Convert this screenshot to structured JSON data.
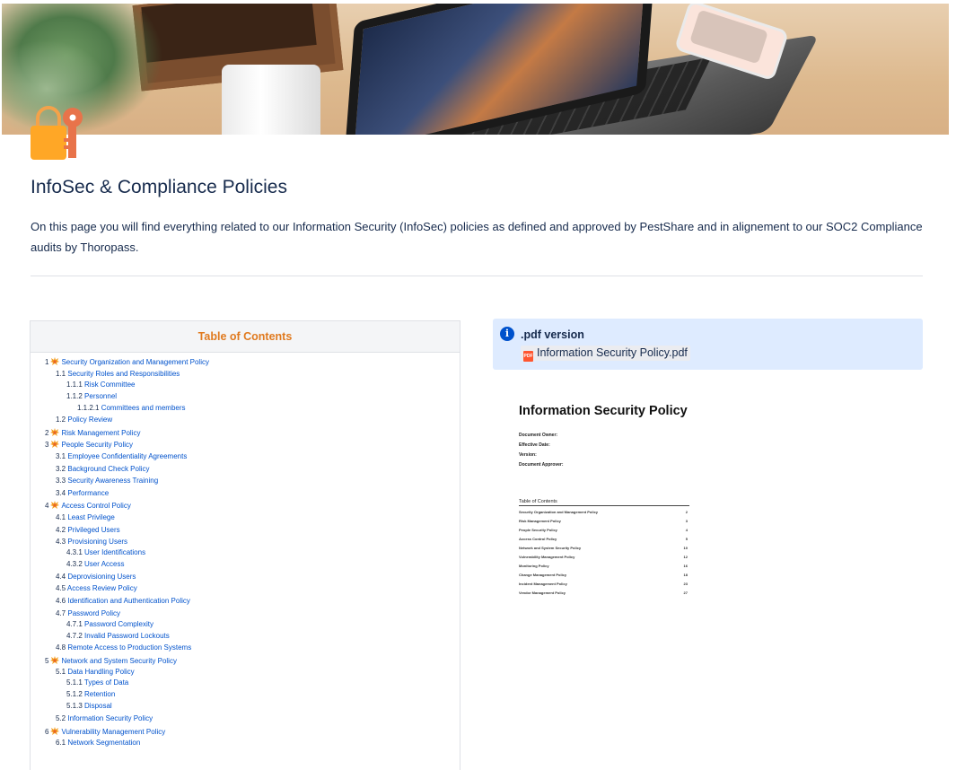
{
  "page": {
    "title": "InfoSec & Compliance Policies",
    "intro": "On this page you will find everything related to our Information Security (InfoSec) policies as defined and approved by PestShare and in alignement to our SOC2 Compliance audits by Thoropass."
  },
  "toc": {
    "heading": "Table of Contents",
    "items": [
      {
        "num": "1",
        "label": "Security Organization and Management Policy",
        "level": 0,
        "flame": true
      },
      {
        "num": "1.1",
        "label": "Security Roles and Responsibilities",
        "level": 1
      },
      {
        "num": "1.1.1",
        "label": "Risk Committee",
        "level": 2
      },
      {
        "num": "1.1.2",
        "label": "Personnel",
        "level": 2
      },
      {
        "num": "1.1.2.1",
        "label": "Committees and members",
        "level": 3
      },
      {
        "num": "1.2",
        "label": "Policy Review",
        "level": 1
      },
      {
        "num": "2",
        "label": "Risk Management Policy",
        "level": 0,
        "flame": true
      },
      {
        "num": "3",
        "label": "People Security Policy",
        "level": 0,
        "flame": true
      },
      {
        "num": "3.1",
        "label": "Employee Confidentiality Agreements",
        "level": 1
      },
      {
        "num": "3.2",
        "label": "Background Check Policy",
        "level": 1
      },
      {
        "num": "3.3",
        "label": "Security Awareness Training",
        "level": 1
      },
      {
        "num": "3.4",
        "label": "Performance",
        "level": 1
      },
      {
        "num": "4",
        "label": "Access Control Policy",
        "level": 0,
        "flame": true
      },
      {
        "num": "4.1",
        "label": "Least Privilege",
        "level": 1
      },
      {
        "num": "4.2",
        "label": "Privileged Users",
        "level": 1
      },
      {
        "num": "4.3",
        "label": "Provisioning Users",
        "level": 1
      },
      {
        "num": "4.3.1",
        "label": "User Identifications",
        "level": 2
      },
      {
        "num": "4.3.2",
        "label": "User Access",
        "level": 2
      },
      {
        "num": "4.4",
        "label": "Deprovisioning Users",
        "level": 1
      },
      {
        "num": "4.5",
        "label": "Access Review Policy",
        "level": 1
      },
      {
        "num": "4.6",
        "label": "Identification and Authentication Policy",
        "level": 1
      },
      {
        "num": "4.7",
        "label": "Password Policy",
        "level": 1
      },
      {
        "num": "4.7.1",
        "label": "Password Complexity",
        "level": 2
      },
      {
        "num": "4.7.2",
        "label": "Invalid Password Lockouts",
        "level": 2
      },
      {
        "num": "4.8",
        "label": "Remote Access to Production Systems",
        "level": 1
      },
      {
        "num": "5",
        "label": "Network and System Security Policy",
        "level": 0,
        "flame": true
      },
      {
        "num": "5.1",
        "label": "Data Handling Policy",
        "level": 1
      },
      {
        "num": "5.1.1",
        "label": "Types of Data",
        "level": 2
      },
      {
        "num": "5.1.2",
        "label": "Retention",
        "level": 2
      },
      {
        "num": "5.1.3",
        "label": "Disposal",
        "level": 2
      },
      {
        "num": "5.2",
        "label": "Information Security Policy",
        "level": 1
      },
      {
        "num": "6",
        "label": "Vulnerability Management Policy",
        "level": 0,
        "flame": true
      },
      {
        "num": "6.1",
        "label": "Network Segmentation",
        "level": 1
      }
    ]
  },
  "info": {
    "title": ".pdf version",
    "pdf_badge": "PDF",
    "attachment": "Information Security Policy.pdf"
  },
  "pdf_preview": {
    "title": "Information Security Policy",
    "meta": [
      "Document Owner:",
      "Effective Date:",
      "Version:",
      "Document Approver:"
    ],
    "toc_title": "Table of Contents",
    "rows": [
      {
        "label": "Security Organization and Management Policy",
        "page": "2"
      },
      {
        "label": "Risk Management Policy",
        "page": "3"
      },
      {
        "label": "People Security Policy",
        "page": "4"
      },
      {
        "label": "Access Control Policy",
        "page": "5"
      },
      {
        "label": "Network and System Security Policy",
        "page": "10"
      },
      {
        "label": "Vulnerability Management Policy",
        "page": "12"
      },
      {
        "label": "Monitoring Policy",
        "page": "16"
      },
      {
        "label": "Change Management Policy",
        "page": "18"
      },
      {
        "label": "Incident Management Policy",
        "page": "23"
      },
      {
        "label": "Vendor Management Policy",
        "page": "27"
      }
    ]
  }
}
